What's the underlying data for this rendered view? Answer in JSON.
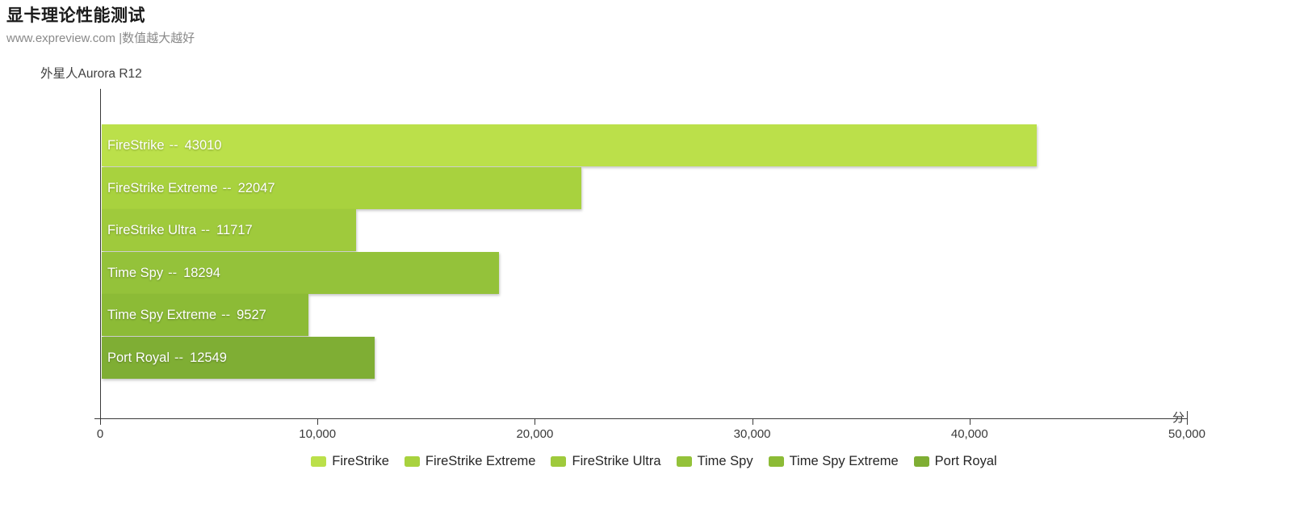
{
  "header": {
    "title": "显卡理论性能测试",
    "subtitle": "www.expreview.com |数值越大越好"
  },
  "chart_data": {
    "type": "bar",
    "orientation": "horizontal",
    "title": "显卡理论性能测试",
    "subtitle": "www.expreview.com |数值越大越好",
    "series_name": "外星人Aurora R12",
    "categories": [
      "FireStrike",
      "FireStrike Extreme",
      "FireStrike Ultra",
      "Time Spy",
      "Time Spy Extreme",
      "Port Royal"
    ],
    "values": [
      43010,
      22047,
      11717,
      18294,
      9527,
      12549
    ],
    "value_separator": "--",
    "bar_labels": [
      "FireStrike  --  43010",
      "FireStrike Extreme  --  22047",
      "FireStrike Ultra  --  11717",
      "Time Spy  --  18294",
      "Time Spy Extreme  --  9527",
      "Port Royal  --  12549"
    ],
    "colors": [
      "#bbe04a",
      "#a8d23e",
      "#9fca3c",
      "#94c23a",
      "#8cbb36",
      "#7fae34"
    ],
    "xlabel": "",
    "x_unit": "分",
    "ylabel": "",
    "xlim": [
      0,
      50000
    ],
    "xticks": [
      0,
      10000,
      20000,
      30000,
      40000,
      50000
    ],
    "xtick_labels": [
      "0",
      "10,000",
      "20,000",
      "30,000",
      "40,000",
      "50,000"
    ],
    "grid": false,
    "legend_position": "bottom",
    "legend": [
      {
        "label": "FireStrike",
        "color": "#bbe04a"
      },
      {
        "label": "FireStrike Extreme",
        "color": "#a8d23e"
      },
      {
        "label": "FireStrike Ultra",
        "color": "#9fca3c"
      },
      {
        "label": "Time Spy",
        "color": "#94c23a"
      },
      {
        "label": "Time Spy Extreme",
        "color": "#8cbb36"
      },
      {
        "label": "Port Royal",
        "color": "#7fae34"
      }
    ]
  }
}
